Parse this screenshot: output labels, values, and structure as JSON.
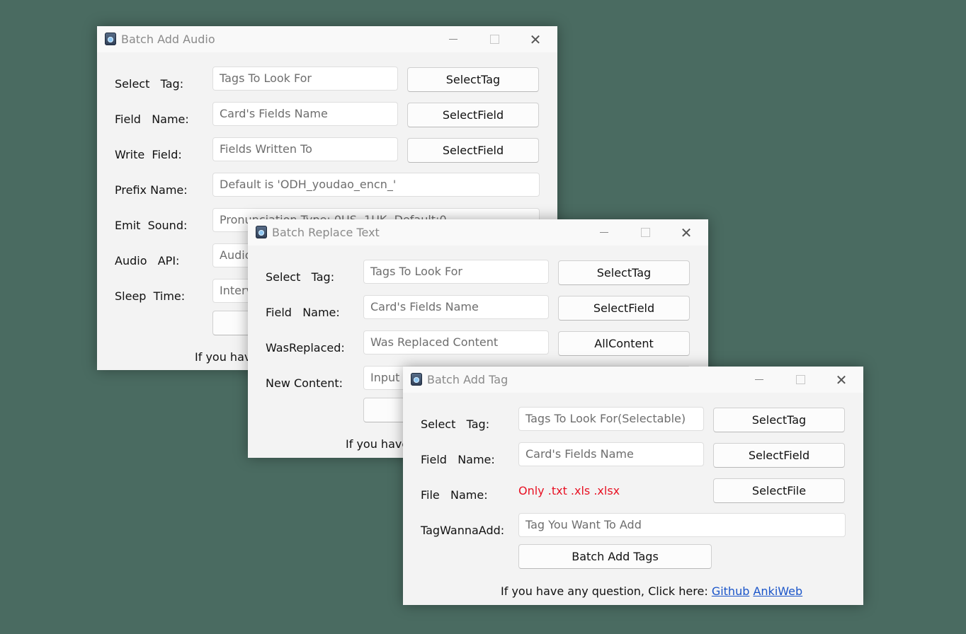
{
  "audio_window": {
    "title": "Batch Add Audio",
    "rows": [
      {
        "label": "Select   Tag:",
        "placeholder": "Tags To Look For",
        "button": "SelectTag"
      },
      {
        "label": "Field   Name:",
        "placeholder": "Card's Fields Name",
        "button": "SelectField"
      },
      {
        "label": "Write  Field:",
        "placeholder": "Fields Written To",
        "button": "SelectField"
      },
      {
        "label": "Prefix Name:",
        "placeholder": "Default is 'ODH_youdao_encn_'"
      },
      {
        "label": "Emit  Sound:",
        "placeholder": "Pronunciation Type: 0US, 1UK, Default:0"
      },
      {
        "label": "Audio   API:",
        "placeholder": "Audio"
      },
      {
        "label": "Sleep  Time:",
        "placeholder": "Interval"
      }
    ],
    "footer_partial": "If you have"
  },
  "replace_window": {
    "title": "Batch Replace Text",
    "rows": [
      {
        "label": "Select   Tag:",
        "placeholder": "Tags To Look For",
        "button": "SelectTag"
      },
      {
        "label": "Field   Name:",
        "placeholder": "Card's Fields Name",
        "button": "SelectField"
      },
      {
        "label": "WasReplaced:",
        "placeholder": "Was Replaced Content",
        "button": "AllContent"
      },
      {
        "label": "New Content:",
        "placeholder": "Input S"
      }
    ],
    "footer_partial": "If you have"
  },
  "tag_window": {
    "title": "Batch Add Tag",
    "rows": [
      {
        "label": "Select   Tag:",
        "placeholder": "Tags To Look For(Selectable)",
        "button": "SelectTag"
      },
      {
        "label": "Field   Name:",
        "placeholder": "Card's Fields Name",
        "button": "SelectField"
      },
      {
        "label": "File   Name:",
        "hint": "Only .txt .xls .xlsx",
        "button": "SelectFile"
      },
      {
        "label": "TagWannaAdd:",
        "placeholder": "Tag You Want To Add"
      }
    ],
    "action_button": "Batch Add Tags",
    "footer_text": "If you have any question, Click here: ",
    "links": [
      "Github",
      "AnkiWeb"
    ]
  },
  "colors": {
    "desktop": "#4a6b61",
    "window": "#f3f3f3",
    "hint_red": "#e81123",
    "link": "#1a55c9"
  },
  "icons": [
    "app-icon",
    "minimize-icon",
    "maximize-icon",
    "close-icon"
  ]
}
